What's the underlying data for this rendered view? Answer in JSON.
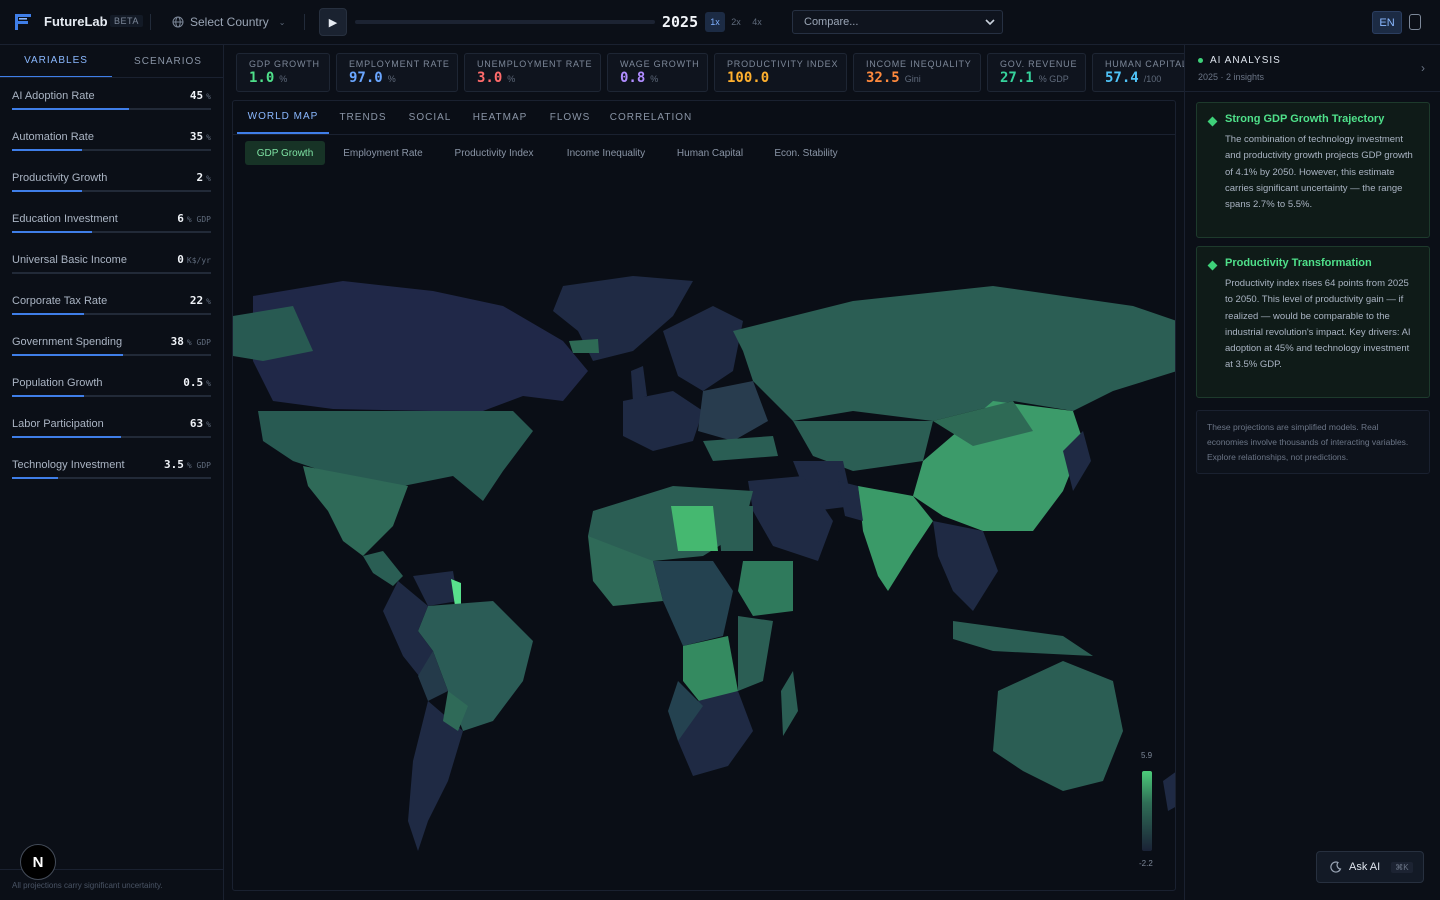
{
  "header": {
    "app_name": "FutureLab",
    "badge": "BETA",
    "country_select": "Select Country",
    "year": "2025",
    "speeds": [
      "1x",
      "2x",
      "4x"
    ],
    "active_speed": "1x",
    "compare_placeholder": "Compare...",
    "language": "EN"
  },
  "sidebar": {
    "tabs": [
      "VARIABLES",
      "SCENARIOS"
    ],
    "active_tab": "VARIABLES",
    "variables": [
      {
        "name": "AI Adoption Rate",
        "value": "45",
        "unit": "%",
        "level": 0.59
      },
      {
        "name": "Automation Rate",
        "value": "35",
        "unit": "%",
        "level": 0.35
      },
      {
        "name": "Productivity Growth",
        "value": "2",
        "unit": "%",
        "level": 0.35
      },
      {
        "name": "Education Investment",
        "value": "6",
        "unit": "% GDP",
        "level": 0.4
      },
      {
        "name": "Universal Basic Income",
        "value": "0",
        "unit": "K$/yr",
        "level": 0.0
      },
      {
        "name": "Corporate Tax Rate",
        "value": "22",
        "unit": "%",
        "level": 0.36
      },
      {
        "name": "Government Spending",
        "value": "38",
        "unit": "% GDP",
        "level": 0.56
      },
      {
        "name": "Population Growth",
        "value": "0.5",
        "unit": "%",
        "level": 0.36
      },
      {
        "name": "Labor Participation",
        "value": "63",
        "unit": "%",
        "level": 0.55
      },
      {
        "name": "Technology Investment",
        "value": "3.5",
        "unit": "% GDP",
        "level": 0.23
      }
    ],
    "disclaimer": "All projections carry significant uncertainty."
  },
  "metrics": [
    {
      "label": "GDP GROWTH",
      "value": "1.0",
      "unit": "%",
      "color": "#4fe08a"
    },
    {
      "label": "EMPLOYMENT RATE",
      "value": "97.0",
      "unit": "%",
      "color": "#6aa6ff"
    },
    {
      "label": "UNEMPLOYMENT RATE",
      "value": "3.0",
      "unit": "%",
      "color": "#ff6b6b"
    },
    {
      "label": "WAGE GROWTH",
      "value": "0.8",
      "unit": "%",
      "color": "#b08cff"
    },
    {
      "label": "PRODUCTIVITY INDEX",
      "value": "100.0",
      "unit": "",
      "color": "#ffb02e"
    },
    {
      "label": "INCOME INEQUALITY",
      "value": "32.5",
      "unit": "Gini",
      "color": "#ff8a3d"
    },
    {
      "label": "GOV. REVENUE",
      "value": "27.1",
      "unit": "% GDP",
      "color": "#36d39c"
    },
    {
      "label": "HUMAN CAPITAL",
      "value": "57.4",
      "unit": "/100",
      "color": "#4fc3f7"
    }
  ],
  "main": {
    "tabs": [
      "WORLD MAP",
      "TRENDS",
      "SOCIAL",
      "HEATMAP",
      "FLOWS",
      "CORRELATION"
    ],
    "active_tab": "WORLD MAP",
    "chips": [
      "GDP Growth",
      "Employment Rate",
      "Productivity Index",
      "Income Inequality",
      "Human Capital",
      "Econ. Stability"
    ],
    "active_chip": "GDP Growth",
    "legend_max": "5.9",
    "legend_min": "-2.2"
  },
  "ai_panel": {
    "title": "AI ANALYSIS",
    "subtitle": "2025 · 2 insights",
    "insights": [
      {
        "title": "Strong GDP Growth Trajectory",
        "text": "The combination of technology investment and productivity growth projects GDP growth of 4.1% by 2050. However, this estimate carries significant uncertainty — the range spans 2.7% to 5.5%."
      },
      {
        "title": "Productivity Transformation",
        "text": "Productivity index rises 64 points from 2025 to 2050. This level of productivity gain — if realized — would be comparable to the industrial revolution's impact. Key drivers: AI adoption at 45% and technology investment at 3.5% GDP."
      }
    ],
    "note": "These projections are simplified models. Real economies involve thousands of interacting variables. Explore relationships, not predictions.",
    "ask_label": "Ask AI",
    "ask_shortcut": "⌘K"
  },
  "fab_label": "N",
  "colors": {
    "accent": "#3f7ee8",
    "positive": "#3ed179",
    "background": "#0b0f17"
  }
}
